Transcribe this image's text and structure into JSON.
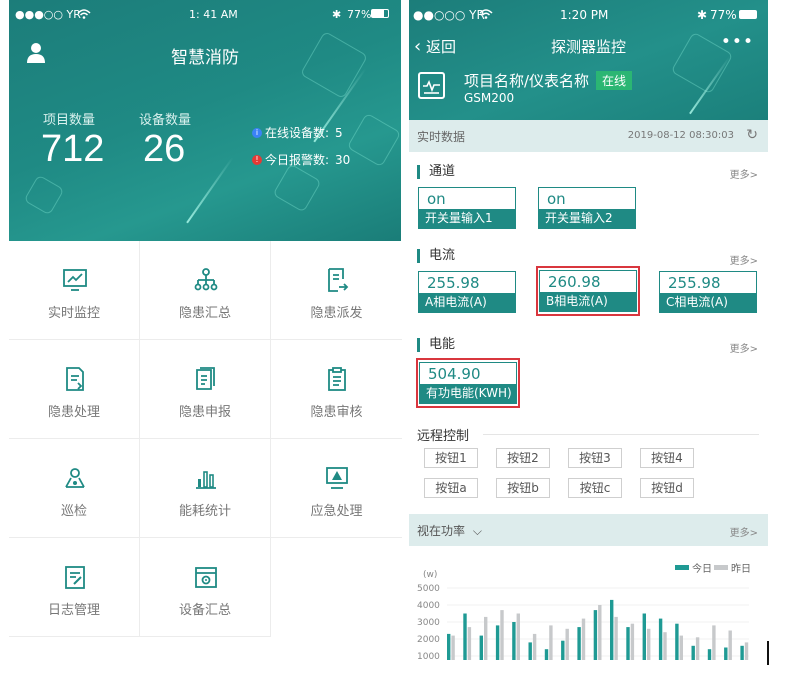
{
  "left": {
    "status_bar": {
      "signal": "●●●○○ YR",
      "wifi": "wifi-icon",
      "time": "1: 41 AM",
      "bluetooth": "✱",
      "battery": "77%"
    },
    "title": "智慧消防",
    "stats": [
      {
        "label": "项目数量",
        "value": "712"
      },
      {
        "label": "设备数量",
        "value": "26"
      }
    ],
    "legend": [
      {
        "text": "在线设备数:",
        "value": "5",
        "color": "#3b82f6"
      },
      {
        "text": "今日报警数:",
        "value": "30",
        "color": "#e53935"
      }
    ],
    "menu": [
      {
        "label": "实时监控",
        "icon": "trend-chart-icon"
      },
      {
        "label": "隐患汇总",
        "icon": "org-tree-icon"
      },
      {
        "label": "隐患派发",
        "icon": "dispatch-doc-icon"
      },
      {
        "label": "隐患处理",
        "icon": "process-doc-icon"
      },
      {
        "label": "隐患申报",
        "icon": "report-doc-icon"
      },
      {
        "label": "隐患审核",
        "icon": "clipboard-icon"
      },
      {
        "label": "巡检",
        "icon": "patrol-icon"
      },
      {
        "label": "能耗统计",
        "icon": "bar-stats-icon"
      },
      {
        "label": "应急处理",
        "icon": "alert-monitor-icon"
      },
      {
        "label": "日志管理",
        "icon": "log-edit-icon"
      },
      {
        "label": "设备汇总",
        "icon": "device-settings-icon"
      }
    ]
  },
  "right": {
    "status_bar": {
      "signal": "●●○○○ YR",
      "time": "1:20 PM",
      "bluetooth": "✱",
      "battery": "77%"
    },
    "back_label": "返回",
    "title": "探测器监控",
    "more": "•••",
    "project_name": "项目名称/仪表名称",
    "online_badge": "在线",
    "device_model": "GSM200",
    "realtime_label": "实时数据",
    "timestamp": "2019-08-12 08:30:03",
    "channel": {
      "title": "通道",
      "more": "更多>",
      "items": [
        {
          "value": "on",
          "name": "开关量输入1"
        },
        {
          "value": "on",
          "name": "开关量输入2"
        }
      ]
    },
    "current": {
      "title": "电流",
      "more": "更多>",
      "items": [
        {
          "value": "255.98",
          "name": "A相电流(A)"
        },
        {
          "value": "260.98",
          "name": "B相电流(A)"
        },
        {
          "value": "255.98",
          "name": "C相电流(A)"
        }
      ]
    },
    "energy": {
      "title": "电能",
      "more": "更多>",
      "items": [
        {
          "value": "504.90",
          "name": "有功电能(KWH)"
        }
      ]
    },
    "remote": {
      "title": "远程控制",
      "buttons": [
        "按钮1",
        "按钮2",
        "按钮3",
        "按钮4",
        "按钮a",
        "按钮b",
        "按钮c",
        "按钮d"
      ]
    },
    "chart_header": {
      "title": "视在功率",
      "more": "更多>"
    }
  },
  "chart_data": {
    "type": "bar",
    "ylabel": "(w)",
    "yticks": [
      5000,
      4000,
      3000,
      2000,
      1000
    ],
    "legend_position": "top-right",
    "series": [
      {
        "name": "今日",
        "color": "#1f9a94",
        "values": [
          2300,
          3500,
          2200,
          2800,
          3000,
          1800,
          1400,
          1900,
          2700,
          3700,
          4300,
          2700,
          3500,
          3200,
          2900,
          1600,
          1400,
          1500,
          1600
        ]
      },
      {
        "name": "昨日",
        "color": "#c7c9cb",
        "values": [
          2200,
          2700,
          3300,
          3700,
          3500,
          2300,
          2800,
          2600,
          3200,
          4000,
          3300,
          2900,
          2600,
          2400,
          2200,
          2100,
          2800,
          2500,
          1800
        ]
      }
    ]
  }
}
